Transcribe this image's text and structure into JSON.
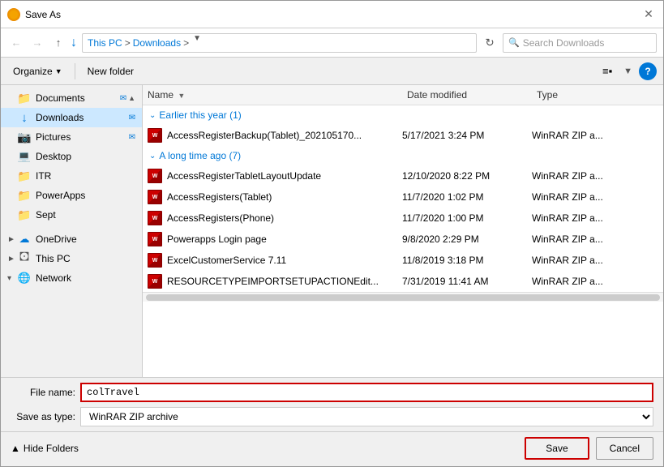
{
  "titleBar": {
    "title": "Save As",
    "closeLabel": "✕"
  },
  "addressBar": {
    "backBtn": "←",
    "forwardBtn": "→",
    "upBtn": "↑",
    "downloadArrow": "↓",
    "breadcrumb": [
      "This PC",
      "Downloads"
    ],
    "dropdownArrow": "▾",
    "refreshBtn": "⟳",
    "searchPlaceholder": "Search Downloads"
  },
  "toolbar": {
    "organizeLabel": "Organize",
    "newFolderLabel": "New folder",
    "viewIcon": "⊞",
    "helpLabel": "?"
  },
  "sidebar": {
    "items": [
      {
        "id": "documents",
        "label": "Documents",
        "iconType": "folder-yellow",
        "pinned": true,
        "expanded": false
      },
      {
        "id": "downloads",
        "label": "Downloads",
        "iconType": "folder-blue",
        "pinned": true,
        "active": true
      },
      {
        "id": "pictures",
        "label": "Pictures",
        "iconType": "folder-yellow",
        "pinned": true
      },
      {
        "id": "desktop",
        "label": "Desktop",
        "iconType": "folder-light"
      },
      {
        "id": "itr",
        "label": "ITR",
        "iconType": "folder-yellow"
      },
      {
        "id": "powerapps",
        "label": "PowerApps",
        "iconType": "folder-yellow"
      },
      {
        "id": "sept",
        "label": "Sept",
        "iconType": "folder-yellow"
      },
      {
        "id": "onedrive",
        "label": "OneDrive",
        "iconType": "onedrive",
        "expandable": true
      },
      {
        "id": "thispc",
        "label": "This PC",
        "iconType": "thispc",
        "expandable": true
      },
      {
        "id": "network",
        "label": "Network",
        "iconType": "network",
        "expandable": true
      }
    ]
  },
  "fileList": {
    "columns": {
      "name": "Name",
      "dateModified": "Date modified",
      "type": "Type"
    },
    "groups": [
      {
        "id": "earlier-this-year",
        "label": "Earlier this year (1)",
        "chevron": "∨",
        "files": [
          {
            "name": "AccessRegisterBackup(Tablet)_202105170...",
            "date": "5/17/2021 3:24 PM",
            "type": "WinRAR ZIP a..."
          }
        ]
      },
      {
        "id": "long-time-ago",
        "label": "A long time ago (7)",
        "chevron": "∨",
        "files": [
          {
            "name": "AccessRegisterTabletLayoutUpdate",
            "date": "12/10/2020 8:22 PM",
            "type": "WinRAR ZIP a..."
          },
          {
            "name": "AccessRegisters(Tablet)",
            "date": "11/7/2020 1:02 PM",
            "type": "WinRAR ZIP a..."
          },
          {
            "name": "AccessRegisters(Phone)",
            "date": "11/7/2020 1:00 PM",
            "type": "WinRAR ZIP a..."
          },
          {
            "name": "Powerapps Login page",
            "date": "9/8/2020 2:29 PM",
            "type": "WinRAR ZIP a..."
          },
          {
            "name": "ExcelCustomerService 7.11",
            "date": "11/8/2019 3:18 PM",
            "type": "WinRAR ZIP a..."
          },
          {
            "name": "RESOURCETYPEIMPORTSETUPACTIONEdit...",
            "date": "7/31/2019 11:41 AM",
            "type": "WinRAR ZIP a..."
          }
        ]
      }
    ]
  },
  "bottomPanel": {
    "fileNameLabel": "File name:",
    "fileNameValue": "colTravel",
    "saveTypeLabel": "Save as type:",
    "saveTypeValue": "WinRAR ZIP archive",
    "hideFoldersLabel": "Hide Folders",
    "saveLabel": "Save",
    "cancelLabel": "Cancel"
  }
}
